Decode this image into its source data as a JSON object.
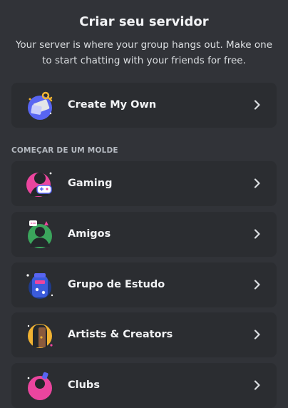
{
  "header": {
    "title": "Criar seu servidor",
    "subtitle": "Your server is where your group hangs out. Make one to start chatting with your friends for free."
  },
  "create_own": {
    "label": "Create My Own",
    "icon": "create-server-icon"
  },
  "templates": {
    "section_label": "COMEÇAR DE UM MOLDE",
    "items": [
      {
        "label": "Gaming",
        "icon": "gaming-icon"
      },
      {
        "label": "Amigos",
        "icon": "friends-icon"
      },
      {
        "label": "Grupo de Estudo",
        "icon": "study-group-icon"
      },
      {
        "label": "Artists & Creators",
        "icon": "artists-icon"
      },
      {
        "label": "Clubs",
        "icon": "clubs-icon"
      }
    ]
  },
  "colors": {
    "background": "#313338",
    "card": "#2b2d31",
    "text": "#f2f3f5",
    "muted": "#b5bac1"
  }
}
